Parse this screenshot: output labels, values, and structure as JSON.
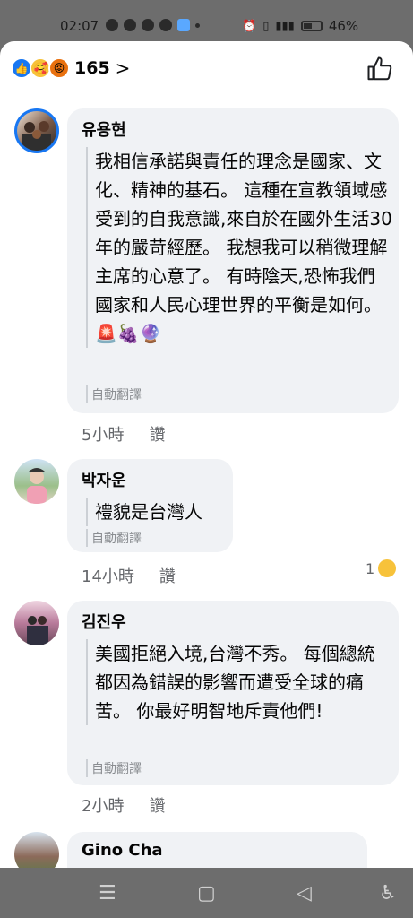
{
  "status_bar": {
    "time": "02:07",
    "battery": "46%"
  },
  "reactions": {
    "count": "165",
    "chevron": ">"
  },
  "comments": [
    {
      "name": "유용현",
      "text": "我相信承諾與責任的理念是國家、文化、精神的基石。 這種在宣教領域感受到的自我意識,來自於在國外生活30年的嚴苛經歷。 我想我可以稍微理解主席的心意了。 有時陰天,恐怖我們國家和人民心理世界的平衡是如何。 🚨🍇🔮",
      "auto_label": "自動翻譯",
      "time": "5小時",
      "like": "讚"
    },
    {
      "name": "박자운",
      "text": "禮貌是台灣人",
      "auto_label": "自動翻譯",
      "time": "14小時",
      "like": "讚",
      "reaction_count": "1"
    },
    {
      "name": "김진우",
      "text": "美國拒絕入境,台灣不秀。 每個總統都因為錯誤的影響而遭受全球的痛苦。 你最好明智地斥責他們!",
      "auto_label": "自動翻譯",
      "time": "2小時",
      "like": "讚"
    },
    {
      "name": "Gino Cha"
    }
  ],
  "colors": {
    "accent": "#1877f2",
    "bubble": "#f0f2f5",
    "meta": "#65676b"
  }
}
